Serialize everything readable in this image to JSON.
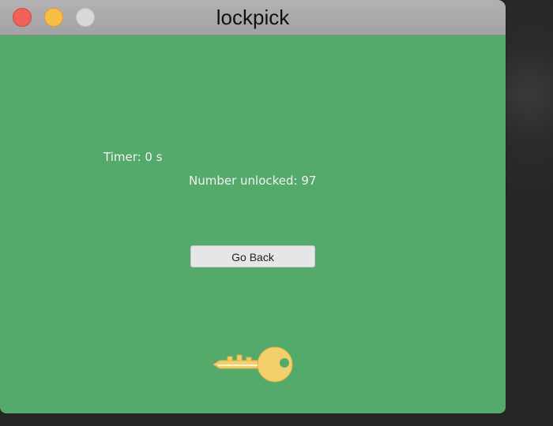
{
  "window": {
    "title": "lockpick",
    "background_color": "#53aa6a"
  },
  "game": {
    "timer_label": "Timer: 0 s",
    "unlocked_label": "Number unlocked: 97",
    "go_back_label": "Go Back",
    "key_icon": "key-icon",
    "key_color": "#f2cf6a"
  }
}
